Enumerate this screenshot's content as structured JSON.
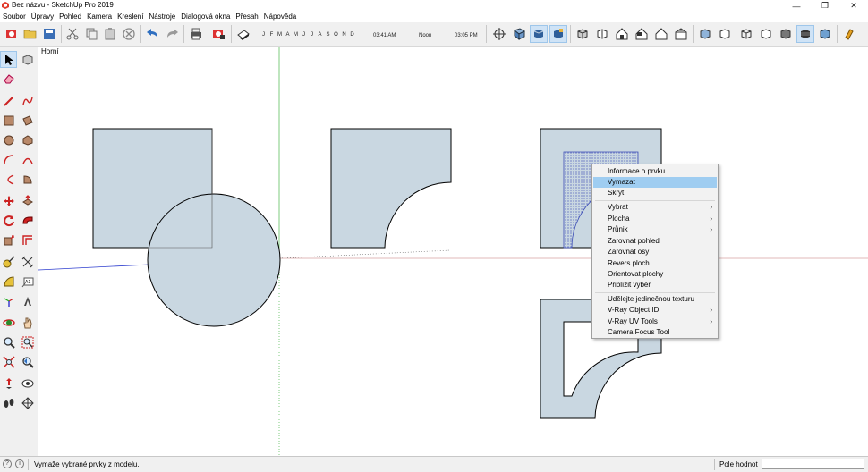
{
  "window": {
    "title": "Bez názvu - SketchUp Pro 2019",
    "controls": [
      "minimize-icon",
      "maximize-icon",
      "close-icon"
    ]
  },
  "menu": [
    "Soubor",
    "Úpravy",
    "Pohled",
    "Kamera",
    "Kreslení",
    "Nástroje",
    "Dialogová okna",
    "Přesah",
    "Nápověda"
  ],
  "shadow": {
    "months": [
      "J",
      "F",
      "M",
      "A",
      "M",
      "J",
      "J",
      "A",
      "S",
      "O",
      "N",
      "D"
    ],
    "time_start": "03:41 AM",
    "time_mid": "Noon",
    "time_end": "03:05 PM"
  },
  "viewport": {
    "scene_label": "Horní"
  },
  "context_menu": {
    "items": [
      {
        "label": "Informace o prvku",
        "submenu": false,
        "highlighted": false
      },
      {
        "label": "Vymazat",
        "submenu": false,
        "highlighted": true
      },
      {
        "label": "Skrýt",
        "submenu": false,
        "highlighted": false
      },
      {
        "label": "Vybrat",
        "submenu": true,
        "highlighted": false
      },
      {
        "label": "Plocha",
        "submenu": true,
        "highlighted": false
      },
      {
        "label": "Průnik",
        "submenu": true,
        "highlighted": false
      },
      {
        "label": "Zarovnat pohled",
        "submenu": false,
        "highlighted": false
      },
      {
        "label": "Zarovnat osy",
        "submenu": false,
        "highlighted": false
      },
      {
        "label": "Revers ploch",
        "submenu": false,
        "highlighted": false
      },
      {
        "label": "Orientovat plochy",
        "submenu": false,
        "highlighted": false
      },
      {
        "label": "Přiblížit výběr",
        "submenu": false,
        "highlighted": false
      },
      {
        "label": "Udělejte jedinečnou texturu",
        "submenu": false,
        "highlighted": false
      },
      {
        "label": "V-Ray Object ID",
        "submenu": true,
        "highlighted": false
      },
      {
        "label": "V-Ray UV Tools",
        "submenu": true,
        "highlighted": false
      },
      {
        "label": "Camera Focus Tool",
        "submenu": false,
        "highlighted": false
      }
    ],
    "submenu_arrow": "›"
  },
  "status": {
    "message": "Vymaže vybrané prvky z modelu.",
    "measure_label": "Pole hodnot",
    "measure_value": ""
  },
  "colors": {
    "face": "#c9d7e1",
    "selection_hl": "#9fcdf1",
    "active_tool": "#cfe3f6"
  }
}
